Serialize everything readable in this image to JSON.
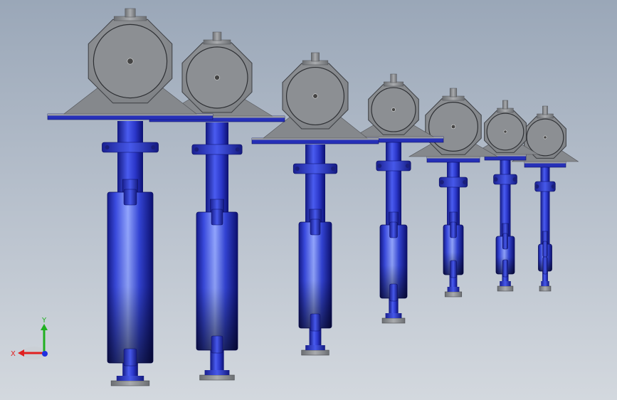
{
  "viewport": {
    "background_top": "#9aa7b8",
    "background_bottom": "#d3d8de"
  },
  "model": {
    "valve_count": 7,
    "body_color": "#2b2fcf",
    "body_dark": "#0c0f6e",
    "body_light": "#6f86ff",
    "actuator_color": "#8a8d90",
    "actuator_light": "#c4c6c8"
  },
  "axis_triad": {
    "x_label": "X",
    "y_label": "Y",
    "x_color": "#e02020",
    "y_color": "#20b020",
    "z_color": "#2030e0"
  }
}
